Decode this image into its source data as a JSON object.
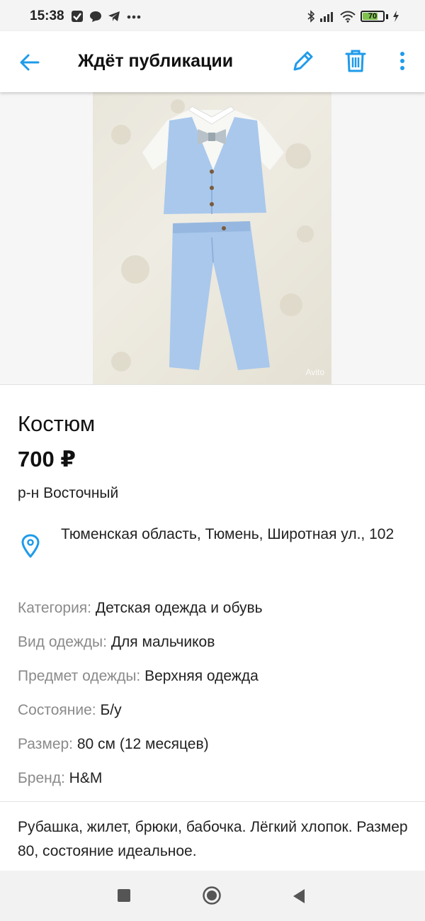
{
  "status_bar": {
    "time": "15:38",
    "battery_level": "70",
    "icons_left": [
      "checkbox-icon",
      "chat-bubble-icon",
      "telegram-icon",
      "more-dots-icon"
    ],
    "icons_right": [
      "bluetooth-icon",
      "signal-icon",
      "wifi-icon",
      "battery-icon",
      "charging-icon"
    ]
  },
  "app_bar": {
    "title": "Ждёт публикации",
    "back_icon": "arrow-left-icon",
    "edit_icon": "pencil-icon",
    "delete_icon": "trash-icon",
    "more_icon": "kebab-menu-icon"
  },
  "photo": {
    "watermark": "Avito"
  },
  "listing": {
    "title": "Костюм",
    "price": "700 ₽",
    "district": "р-н Восточный",
    "address": "Тюменская область, Тюмень, Широтная ул., 102"
  },
  "params": [
    {
      "key": "Категория:",
      "value": "Детская одежда и обувь"
    },
    {
      "key": "Вид одежды:",
      "value": "Для мальчиков"
    },
    {
      "key": "Предмет одежды:",
      "value": "Верхняя одежда"
    },
    {
      "key": "Состояние:",
      "value": "Б/у"
    },
    {
      "key": "Размер:",
      "value": "80 см (12 месяцев)"
    },
    {
      "key": "Бренд:",
      "value": "H&M"
    }
  ],
  "description": "Рубашка, жилет, брюки, бабочка. Лёгкий хлопок. Размер 80, состояние идеальное.",
  "colors": {
    "accent": "#1f9bea",
    "muted_text": "#8a8a8a",
    "battery_fill": "#7ec14d"
  }
}
